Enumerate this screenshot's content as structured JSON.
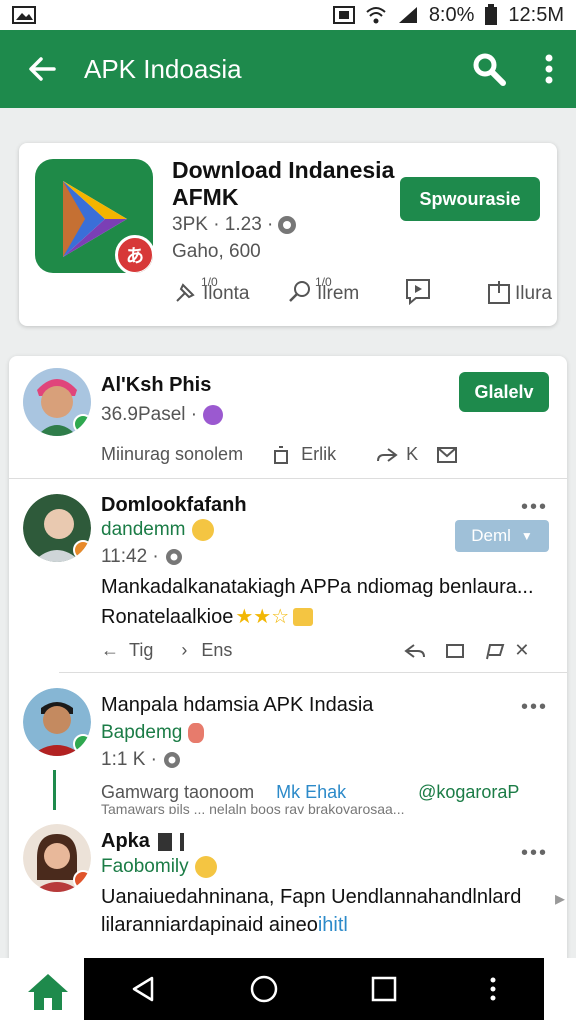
{
  "status_bar": {
    "battery_text": "8:0%",
    "time_text": "12:5M"
  },
  "app_bar": {
    "title": "APK Indoasia",
    "back_icon": "arrow-left-icon",
    "search_icon": "search-icon",
    "menu_icon": "more-vert-icon"
  },
  "app_card": {
    "name": "Download Indanesia AFMK",
    "meta1": "3PK · 1.23 ·",
    "meta2": "Gaho, 600",
    "install_label": "Spwourasie",
    "actions": [
      {
        "sup": "1/0",
        "label": "Ilonta"
      },
      {
        "sup": "1/0",
        "label": "Ilrem"
      },
      {
        "sup": "",
        "label": ""
      },
      {
        "sup": "",
        "label": "Ilura"
      }
    ]
  },
  "posts": [
    {
      "name": "Al'Ksh Phis",
      "line2": "36.9Pasel ·",
      "follow_label": "Glalelv",
      "actions": [
        "Miinurag sonolem",
        "Erlik",
        "K"
      ]
    },
    {
      "name": "Domlookfafanh",
      "line2": "dandemm",
      "line3": "11:42 ·",
      "dropdown_label": "Deml",
      "text1": "Mankadalkanatakiagh APPa ndiomag benlaura...",
      "text2": "Ronatelaalkioe",
      "actions": [
        "Tig",
        "Ens",
        "✕"
      ]
    },
    {
      "name": "Manpala hdamsia APK Indasia",
      "line2": "Bapdemg",
      "line3": "1:1 K ·",
      "actions": [
        "Gamwarg taonoom",
        "Mk Ehak",
        "@kogaroraP"
      ],
      "subtext": "Tamawars pils ... nelaln boos ray brakoyarosaa..."
    },
    {
      "name": "Apka",
      "line2": "Faobomily",
      "text1": "Uanaiuedahninana, Fapn Uendlannahandlnlard",
      "text2": "lilaranniardapinaid aineo",
      "text2_highlight": "ihitl"
    }
  ],
  "colors": {
    "brand_green": "#1e8a4c",
    "link_blue": "#2c8ac9"
  }
}
